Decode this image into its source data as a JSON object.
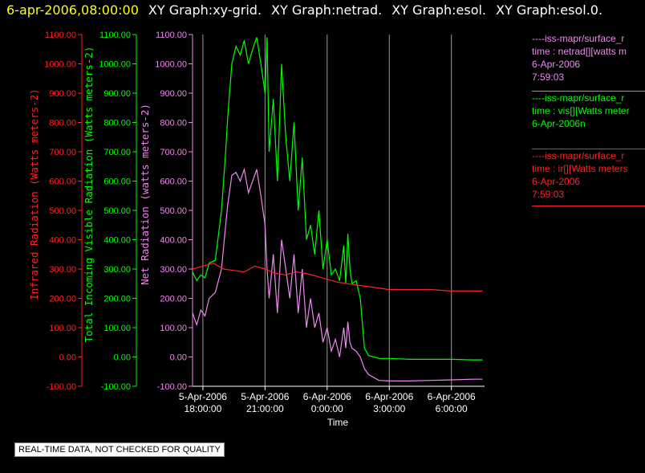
{
  "header": {
    "time": "6-apr-2006,08:00:00",
    "items": [
      "XY Graph:xy-grid.",
      "XY Graph:netrad.",
      "XY Graph:esol.",
      "XY Graph:esol.0."
    ]
  },
  "footer": {
    "note": "REAL-TIME DATA, NOT CHECKED FOR QUALITY"
  },
  "legend": [
    {
      "lines": [
        "----iss-mapr/surface_r",
        "time : netrad[][watts m",
        "6-Apr-2006",
        "7:59:03"
      ],
      "color": "#ee88ee"
    },
    {
      "lines": [
        "----iss-mapr/surface_r",
        "time : vis[][Watts meter",
        "6-Apr-2006n"
      ],
      "color": "#00ff00"
    },
    {
      "lines": [
        "----iss-mapr/surface_r",
        "time : ir[][Watts meters",
        "6-Apr-2006",
        "7:59:03"
      ],
      "color": "#ff2222"
    }
  ],
  "chart_data": {
    "type": "line",
    "xlabel": "Time",
    "xlim": [
      -0.5,
      13.6
    ],
    "x_ticks": [
      {
        "x": 0,
        "label": [
          "5-Apr-2006",
          "18:00:00"
        ]
      },
      {
        "x": 3,
        "label": [
          "5-Apr-2006",
          "21:00:00"
        ]
      },
      {
        "x": 6,
        "label": [
          "6-Apr-2006",
          "0:00:00"
        ]
      },
      {
        "x": 9,
        "label": [
          "6-Apr-2006",
          "3:00:00"
        ]
      },
      {
        "x": 12,
        "label": [
          "6-Apr-2006",
          "6:00:00"
        ]
      }
    ],
    "y_axes": [
      {
        "label": "Infrared Radiation (Watts meters-2)",
        "color": "#ff2222",
        "ticks": [
          "1100.00",
          "1000.00",
          "900.00",
          "800.00",
          "700.00",
          "600.00",
          "500.00",
          "400.00",
          "300.00",
          "200.00",
          "100.00",
          "0.00",
          "-100.00"
        ]
      },
      {
        "label": "Total Incoming Visible Radiation (Watts meters-2)",
        "color": "#00ff00",
        "ticks": [
          "1100.00",
          "1000.00",
          "900.00",
          "800.00",
          "700.00",
          "600.00",
          "500.00",
          "400.00",
          "300.00",
          "200.00",
          "100.00",
          "0.00",
          "-100.00"
        ]
      },
      {
        "label": "Net Radiation (watts meters-2)",
        "color": "#ee88ee",
        "ticks": [
          "1100.00",
          "1000.00",
          "900.00",
          "800.00",
          "700.00",
          "600.00",
          "500.00",
          "400.00",
          "300.00",
          "200.00",
          "100.00",
          "0.00",
          "-100.00"
        ]
      }
    ],
    "ylim": [
      -100,
      1100
    ],
    "grid": "vertical",
    "series": [
      {
        "color": "#00ff00",
        "x": [
          -0.5,
          -0.3,
          -0.1,
          0.1,
          0.3,
          0.6,
          0.9,
          1.1,
          1.2,
          1.4,
          1.6,
          1.8,
          2.0,
          2.2,
          2.4,
          2.6,
          2.8,
          3.0,
          3.1,
          3.2,
          3.4,
          3.6,
          3.8,
          4.0,
          4.2,
          4.4,
          4.6,
          4.8,
          5.0,
          5.2,
          5.4,
          5.6,
          5.8,
          6.0,
          6.2,
          6.4,
          6.6,
          6.8,
          6.9,
          7.0,
          7.1,
          7.2,
          7.4,
          7.6,
          7.8,
          8.0,
          8.5,
          9,
          10,
          11,
          12,
          13,
          13.5
        ],
        "y": [
          290,
          260,
          280,
          270,
          320,
          330,
          500,
          700,
          820,
          1000,
          1060,
          1030,
          1080,
          1000,
          1050,
          1090,
          1000,
          900,
          1090,
          700,
          880,
          600,
          1000,
          750,
          600,
          800,
          500,
          680,
          400,
          450,
          350,
          500,
          300,
          400,
          280,
          300,
          260,
          380,
          250,
          420,
          300,
          250,
          260,
          200,
          30,
          5,
          -5,
          -5,
          -8,
          -8,
          -8,
          -10,
          -10
        ]
      },
      {
        "color": "#ee88ee",
        "x": [
          -0.5,
          -0.3,
          -0.1,
          0.1,
          0.3,
          0.6,
          0.9,
          1.1,
          1.2,
          1.4,
          1.6,
          1.8,
          2.0,
          2.2,
          2.4,
          2.6,
          2.8,
          3.0,
          3.1,
          3.2,
          3.4,
          3.6,
          3.8,
          4.0,
          4.2,
          4.4,
          4.6,
          4.8,
          5.0,
          5.2,
          5.4,
          5.6,
          5.8,
          6.0,
          6.2,
          6.4,
          6.6,
          6.8,
          6.9,
          7.0,
          7.1,
          7.2,
          7.4,
          7.6,
          7.8,
          8.0,
          8.5,
          9,
          10,
          11,
          12,
          13,
          13.5
        ],
        "y": [
          150,
          110,
          160,
          140,
          200,
          220,
          300,
          450,
          520,
          620,
          630,
          600,
          640,
          560,
          600,
          640,
          550,
          450,
          300,
          200,
          350,
          150,
          400,
          300,
          200,
          350,
          150,
          300,
          100,
          200,
          100,
          150,
          50,
          100,
          20,
          60,
          0,
          100,
          30,
          120,
          50,
          30,
          20,
          0,
          -40,
          -60,
          -80,
          -82,
          -82,
          -80,
          -78,
          -76,
          -76
        ]
      },
      {
        "color": "#ff2222",
        "x": [
          -0.5,
          0,
          0.5,
          1,
          1.5,
          2,
          2.5,
          3,
          3.5,
          4,
          4.5,
          5,
          5.5,
          6,
          6.5,
          7,
          7.5,
          8,
          9,
          10,
          11,
          12,
          13,
          13.5
        ],
        "y": [
          300,
          310,
          320,
          300,
          295,
          290,
          310,
          300,
          285,
          280,
          290,
          285,
          275,
          265,
          255,
          250,
          245,
          240,
          230,
          230,
          230,
          225,
          225,
          225
        ]
      }
    ]
  }
}
